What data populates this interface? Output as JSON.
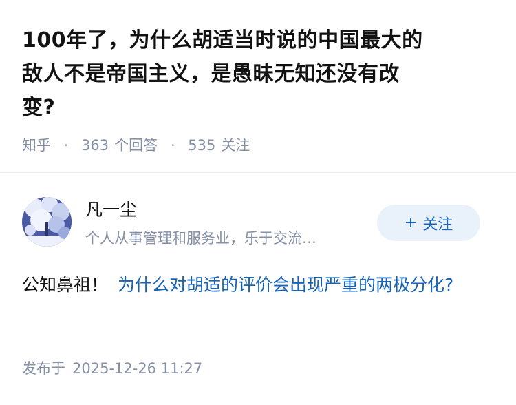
{
  "question": {
    "title": "100年了，为什么胡适当时说的中国最大的\n敌人不是帝国主义，是愚昧无知还没有改\n变?",
    "source": "知乎",
    "separator": "·",
    "answer_count": "363",
    "answer_label": "个回答",
    "follower_count": "535",
    "follower_label": "关注"
  },
  "author": {
    "name": "凡一尘",
    "bio": "个人从事管理和服务业，乐于交流…",
    "follow_icon": "+",
    "follow_label": "关注"
  },
  "answer": {
    "text": "公知鼻祖！",
    "link_text": "为什么对胡适的评价会出现严重的两极分化?"
  },
  "publish": {
    "label": "发布于",
    "time": "2025-12-26 11:27"
  },
  "colors": {
    "link": "#1763b6",
    "muted": "#8590a6",
    "follow_bg": "#e9f1fb"
  }
}
